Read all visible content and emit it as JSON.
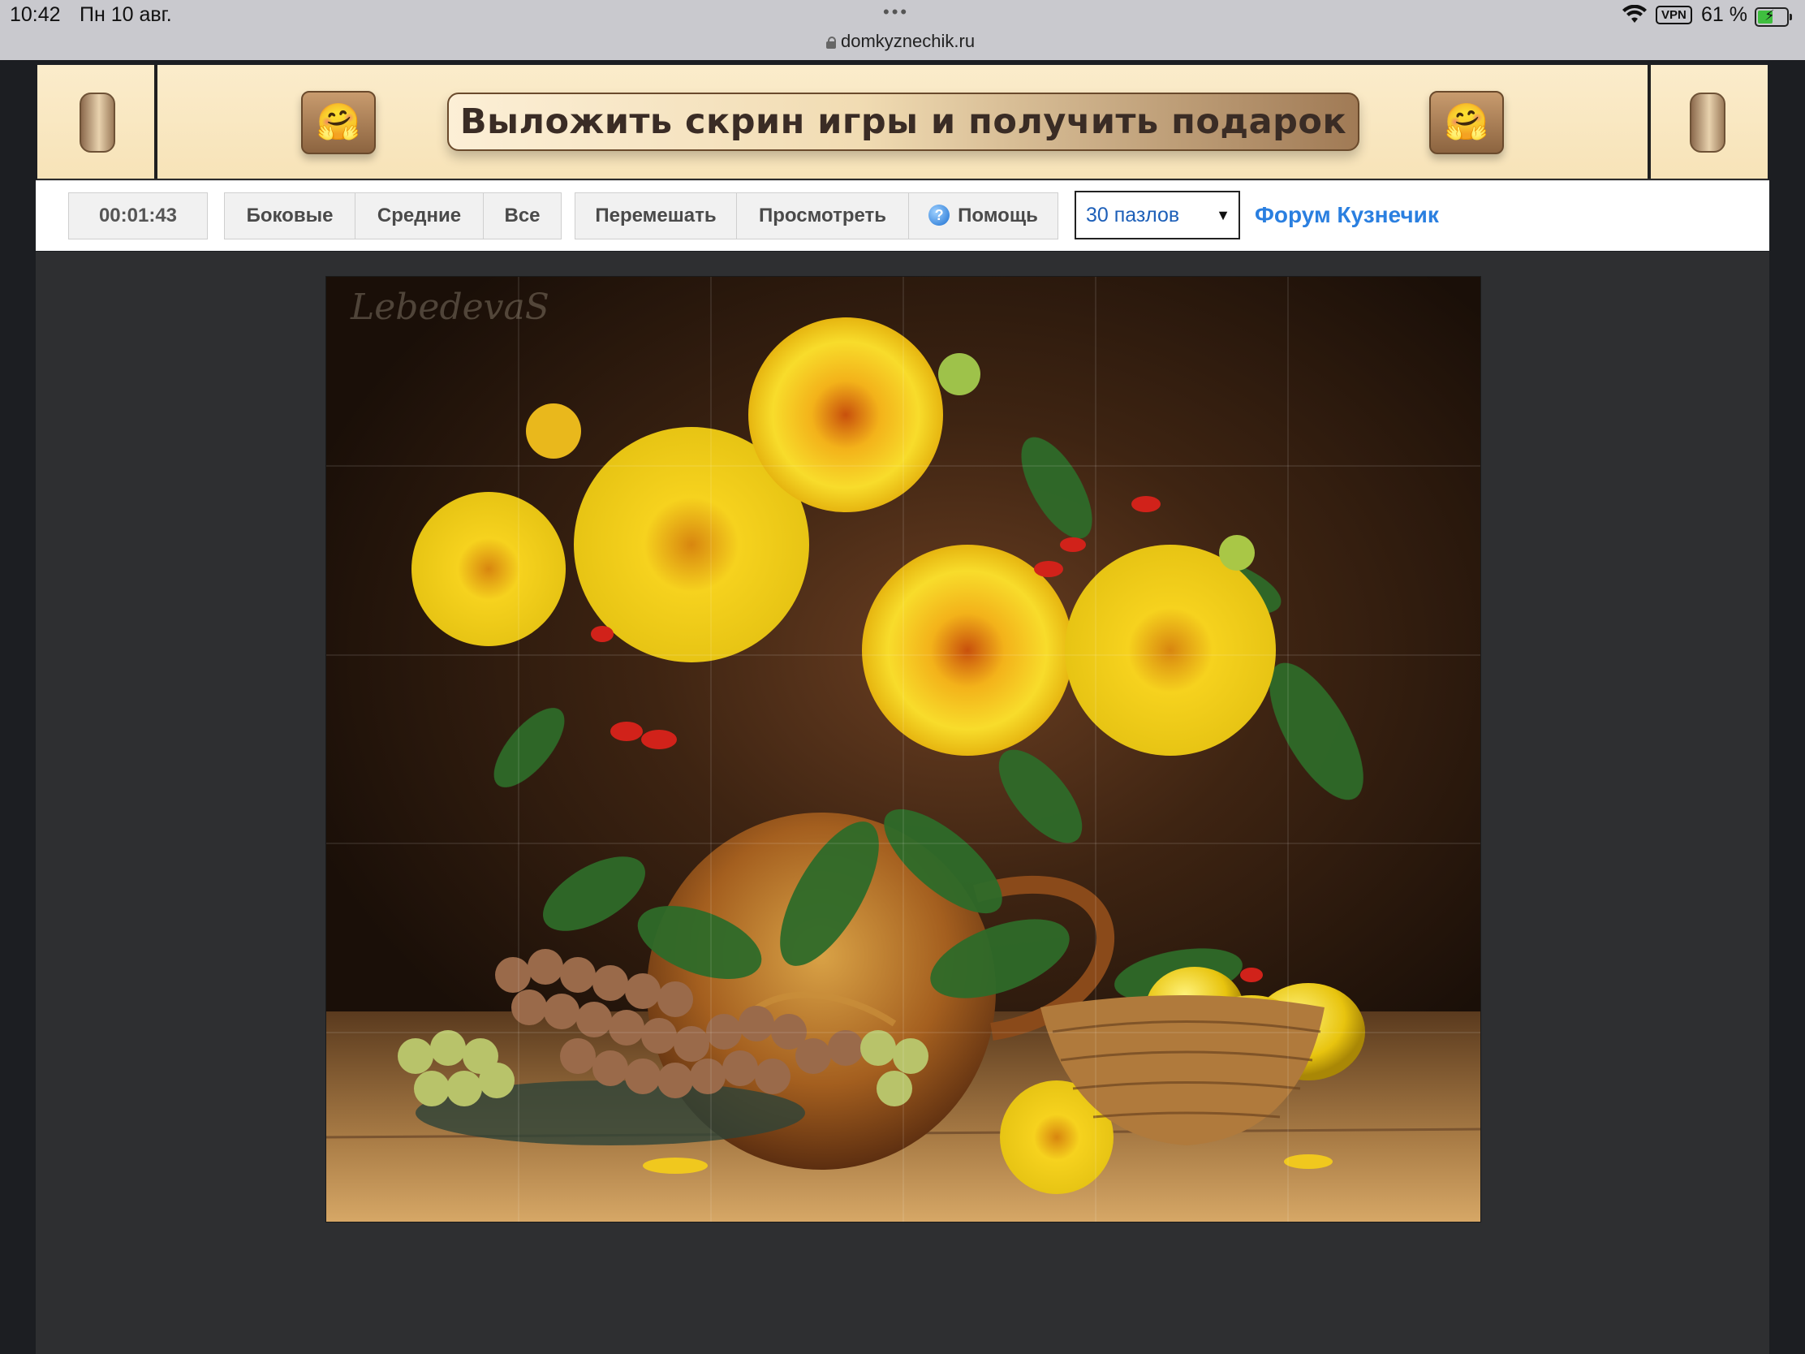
{
  "status_bar": {
    "time": "10:42",
    "date": "Пн 10 авг.",
    "url": "domkyznechik.ru",
    "vpn": "VPN",
    "battery_percent": "61 %",
    "battery_level": 0.61
  },
  "banner": {
    "promo_text": "Выложить скрин игры и получить подарок",
    "left_emoji": "🤗",
    "right_emoji": "🤗"
  },
  "toolbar": {
    "timer": "00:01:43",
    "filter_buttons": [
      "Боковые",
      "Средние",
      "Все"
    ],
    "action_buttons": {
      "shuffle": "Перемешать",
      "preview": "Просмотреть",
      "help": "Помощь"
    },
    "piece_count_select": "30 пазлов",
    "forum_link": "Форум Кузнечик"
  },
  "board": {
    "watermark": "LebedevaS",
    "columns": 6,
    "rows": 5,
    "colors": {
      "background": "#2e2f31",
      "accent_link": "#2a7fe0"
    }
  }
}
